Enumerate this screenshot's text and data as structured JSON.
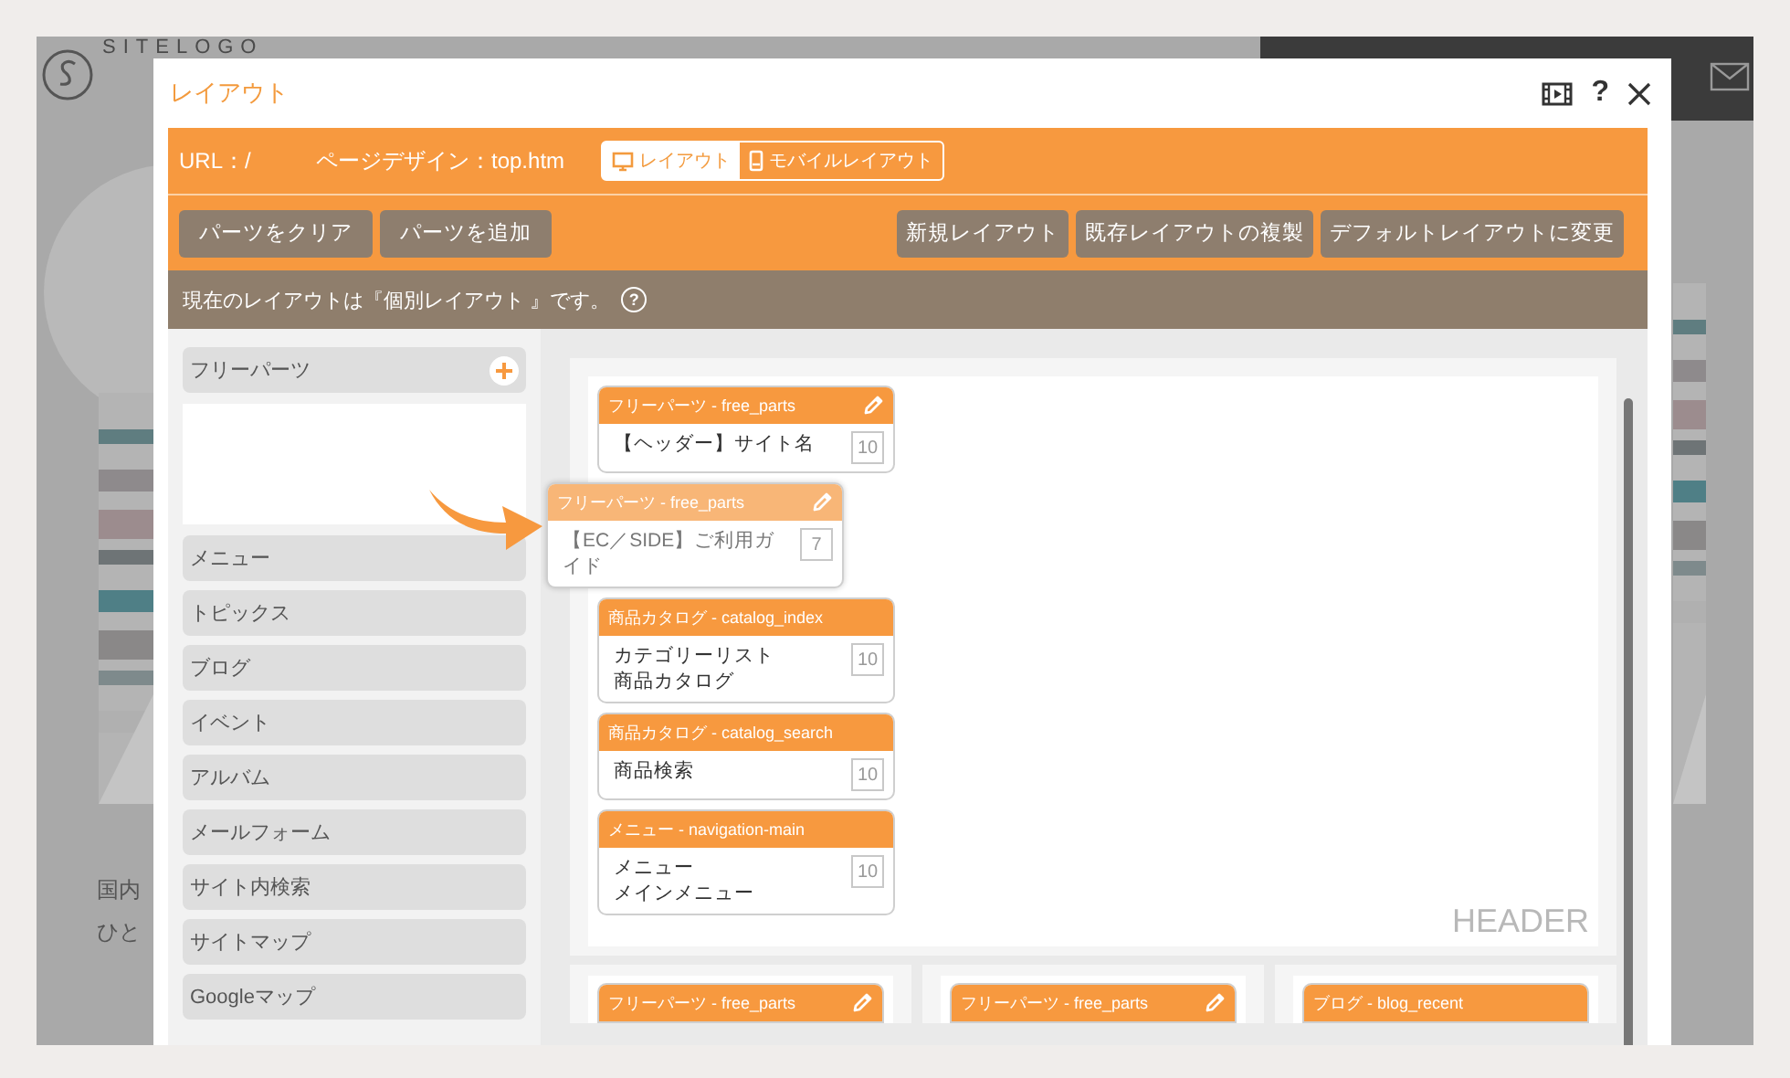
{
  "background_site": {
    "logo": "SITELOGO",
    "text_lines": [
      "国内",
      "ひと"
    ]
  },
  "dialog": {
    "title": "レイアウト",
    "help": "?"
  },
  "toolbar": {
    "url": "URL：/",
    "page_design": "ページデザイン：top.htm",
    "view_tabs": [
      {
        "label": "レイアウト",
        "selected": true
      },
      {
        "label": "モバイルレイアウト",
        "selected": false
      }
    ],
    "left_buttons": [
      "パーツをクリア",
      "パーツを追加"
    ],
    "right_buttons": [
      "新規レイアウト",
      "既存レイアウトの複製",
      "デフォルトレイアウトに変更"
    ]
  },
  "notice": {
    "text": "現在のレイアウトは『個別レイアウト 』です。",
    "help": "?"
  },
  "palette": {
    "free_parts": "フリーパーツ",
    "items": [
      "メニュー",
      "トピックス",
      "ブログ",
      "イベント",
      "アルバム",
      "メールフォーム",
      "サイト内検索",
      "サイトマップ",
      "Googleマップ"
    ]
  },
  "header_area": {
    "label": "HEADER",
    "cards": [
      {
        "title": "フリーパーツ - free_parts",
        "editable": true,
        "dragging": false,
        "lines": [
          "【ヘッダー】サイト名"
        ],
        "count": "10"
      },
      {
        "title": "フリーパーツ - free_parts",
        "editable": true,
        "dragging": true,
        "lines": [
          "【EC／SIDE】ご利用ガイド"
        ],
        "count": "7"
      },
      {
        "title": "商品カタログ - catalog_index",
        "editable": false,
        "dragging": false,
        "lines": [
          "カテゴリーリスト",
          "商品カタログ"
        ],
        "count": "10"
      },
      {
        "title": "商品カタログ - catalog_search",
        "editable": false,
        "dragging": false,
        "lines": [
          "商品検索"
        ],
        "count": "10"
      },
      {
        "title": "メニュー - navigation-main",
        "editable": false,
        "dragging": false,
        "lines": [
          "メニュー",
          "メインメニュー"
        ],
        "count": "10"
      }
    ]
  },
  "columns": [
    {
      "cards": [
        {
          "title": "フリーパーツ - free_parts",
          "editable": true
        }
      ]
    },
    {
      "cards": [
        {
          "title": "フリーパーツ - free_parts",
          "editable": true
        }
      ]
    },
    {
      "cards": [
        {
          "title": "ブログ - blog_recent",
          "editable": false
        }
      ]
    }
  ]
}
